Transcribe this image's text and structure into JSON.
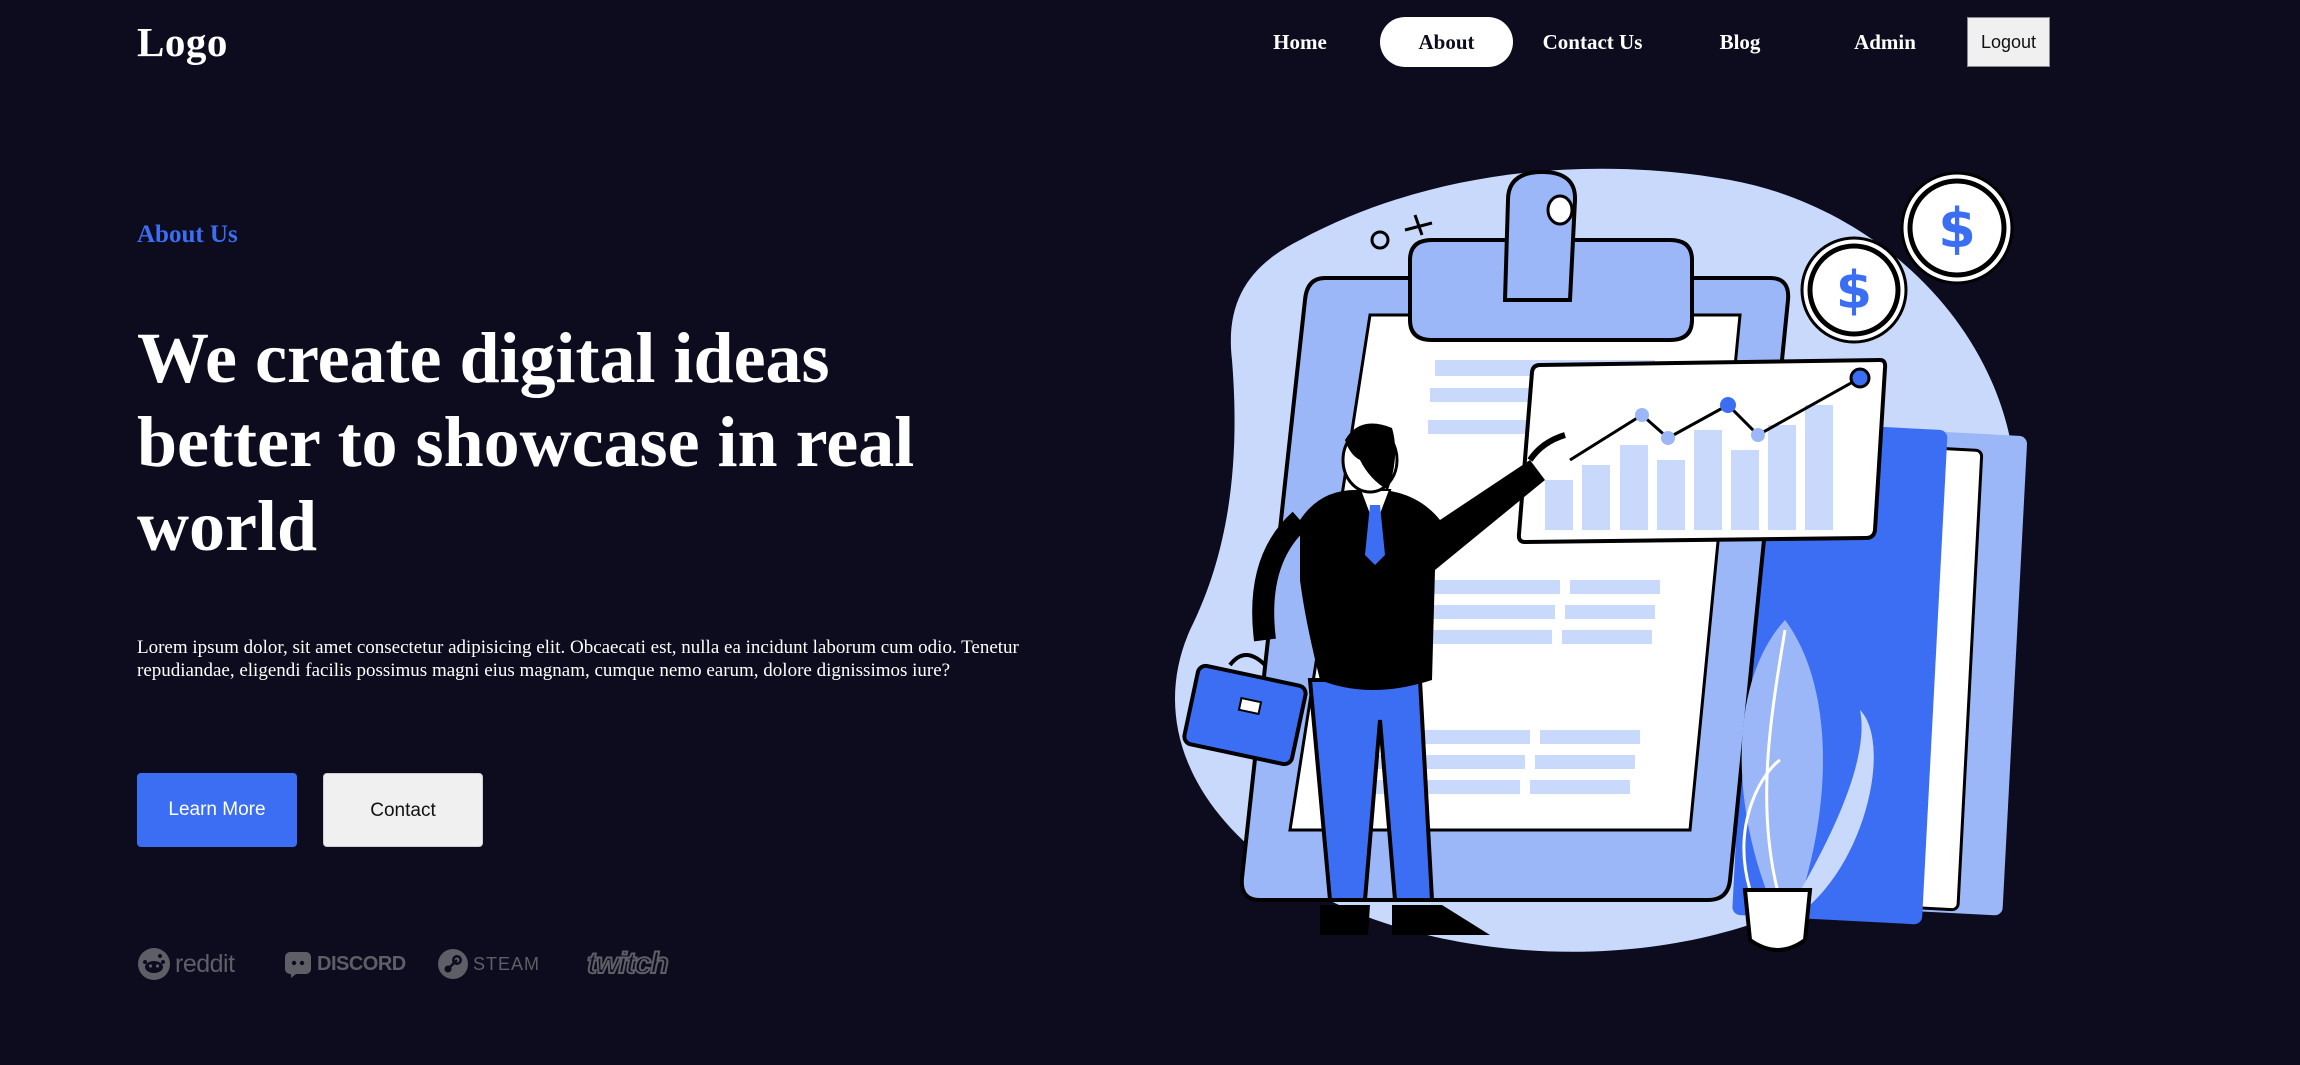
{
  "header": {
    "logo": "Logo",
    "nav": [
      {
        "label": "Home",
        "active": false
      },
      {
        "label": "About",
        "active": true
      },
      {
        "label": "Contact Us",
        "active": false
      },
      {
        "label": "Blog",
        "active": false
      },
      {
        "label": "Admin",
        "active": false
      }
    ],
    "logout_label": "Logout"
  },
  "hero": {
    "eyebrow": "About Us",
    "headline_lines": [
      "We create digital ideas",
      "better to showcase in real",
      "world"
    ],
    "description": "Lorem ipsum dolor, sit amet consectetur adipisicing elit. Obcaecati est, nulla ea incidunt laborum cum odio. Tenetur repudiandae, eligendi facilis possimus magni eius magnam, cumque nemo earum, dolore dignissimos iure?",
    "primary_button": "Learn More",
    "secondary_button": "Contact"
  },
  "brands": [
    {
      "name": "reddit",
      "icon": "reddit-icon"
    },
    {
      "name": "DISCORD",
      "icon": "discord-icon"
    },
    {
      "name": "STEAM",
      "icon": "steam-icon"
    },
    {
      "name": "twitch",
      "icon": "twitch-icon"
    }
  ],
  "illustration": {
    "icon": "business-analytics-illustration",
    "currency_symbol": "$"
  },
  "colors": {
    "background": "#0d0c1f",
    "accent": "#3b6ef2",
    "light_blue": "#c9d9fb",
    "mid_blue": "#9bb7f7",
    "muted_logo": "#5e5e66"
  }
}
